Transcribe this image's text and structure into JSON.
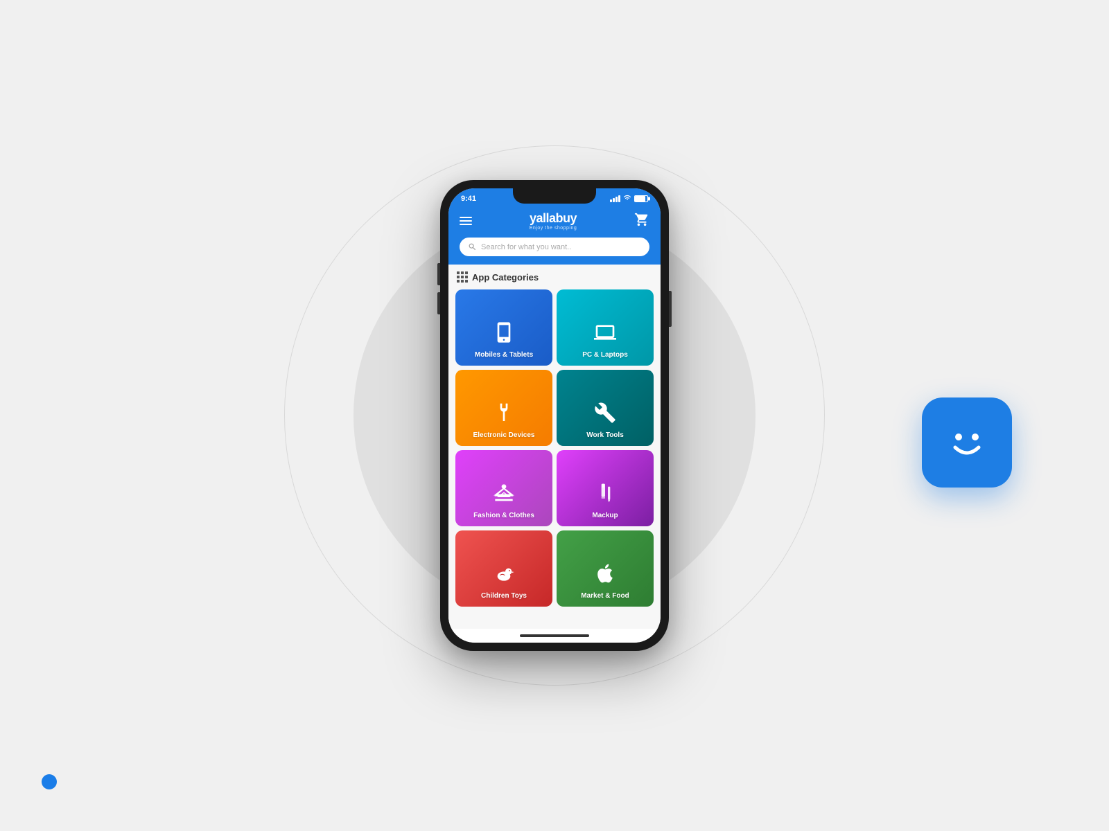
{
  "app": {
    "name": "yallabuy",
    "subtitle": "Enjoy the shopping"
  },
  "status_bar": {
    "time": "9:41",
    "signal": "full",
    "wifi": true,
    "battery": "full"
  },
  "search": {
    "placeholder": "Search for what you want.."
  },
  "categories_section": {
    "title": "App Categories",
    "items": [
      {
        "id": "mobiles",
        "label": "Mobiles & Tablets",
        "color_class": "card-mobiles",
        "icon": "mobile"
      },
      {
        "id": "pc",
        "label": "PC & Laptops",
        "color_class": "card-pc",
        "icon": "laptop"
      },
      {
        "id": "electronic",
        "label": "Electronic Devices",
        "color_class": "card-electronic",
        "icon": "plug"
      },
      {
        "id": "worktools",
        "label": "Work Tools",
        "color_class": "card-worktools",
        "icon": "wrench"
      },
      {
        "id": "fashion",
        "label": "Fashion & Clothes",
        "color_class": "card-fashion",
        "icon": "hanger"
      },
      {
        "id": "mackup",
        "label": "Mackup",
        "color_class": "card-mackup",
        "icon": "makeup"
      },
      {
        "id": "children",
        "label": "Children Toys",
        "color_class": "card-children",
        "icon": "duck"
      },
      {
        "id": "market",
        "label": "Market & Food",
        "color_class": "card-market",
        "icon": "apple"
      }
    ]
  },
  "blue_dot": true
}
